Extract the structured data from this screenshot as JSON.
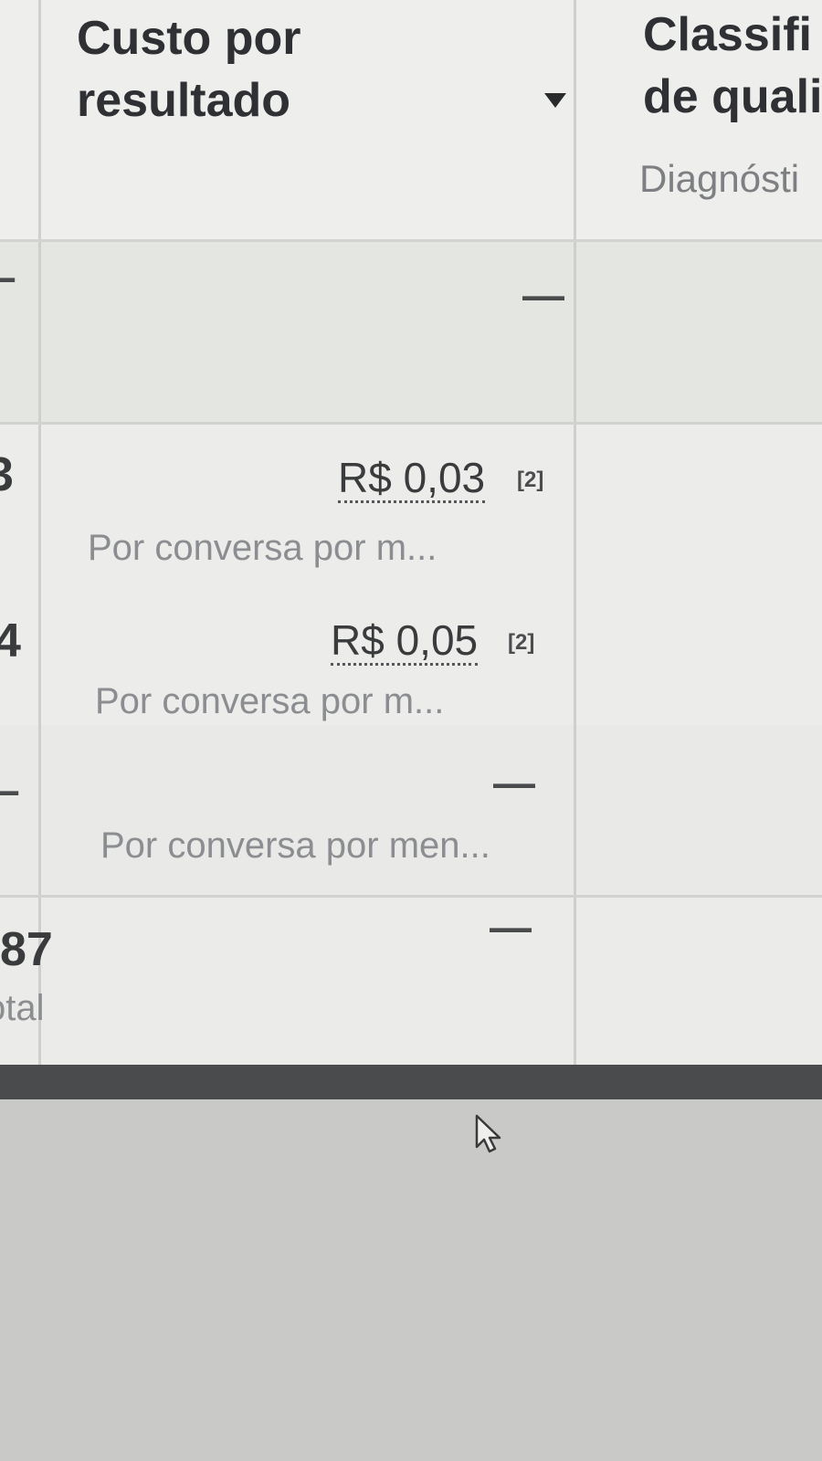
{
  "table": {
    "columns": [
      {
        "title_line1": "Custo por",
        "title_line2": "resultado"
      },
      {
        "title_line1": "Classifi",
        "title_line2": "de quali",
        "subtitle": "Diagnósti"
      }
    ],
    "left_column_values": [
      "–",
      "3",
      "4",
      "–",
      "87"
    ],
    "left_column_total_label": "otal",
    "rows": [
      {
        "cost": "—",
        "desc": ""
      },
      {
        "cost": "R$ 0,03",
        "footnote": "[2]",
        "desc": "Por conversa por m..."
      },
      {
        "cost": "R$ 0,05",
        "footnote": "[2]",
        "desc": "Por conversa por m..."
      },
      {
        "cost": "—",
        "desc": "Por conversa por men..."
      },
      {
        "cost": "—",
        "desc": ""
      }
    ]
  }
}
